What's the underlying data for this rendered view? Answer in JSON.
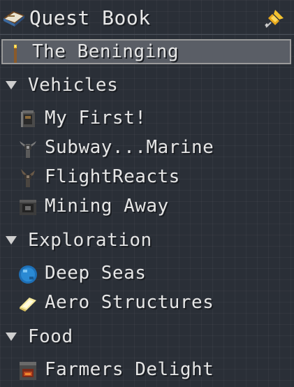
{
  "header": {
    "title": "Quest Book",
    "book_icon": "book-icon",
    "pin_icon": "pin-icon"
  },
  "selected": {
    "label": "The Beninging",
    "icon": "torch-icon"
  },
  "categories": [
    {
      "label": "Vehicles",
      "items": [
        {
          "label": "My First!",
          "icon": "engine-block-icon"
        },
        {
          "label": "Subway...Marine",
          "icon": "propeller-icon"
        },
        {
          "label": "FlightReacts",
          "icon": "flight-propeller-icon"
        },
        {
          "label": "Mining Away",
          "icon": "drill-block-icon"
        }
      ]
    },
    {
      "label": "Exploration",
      "items": [
        {
          "label": "Deep Seas",
          "icon": "water-orb-icon"
        },
        {
          "label": "Aero Structures",
          "icon": "glowing-crystal-icon"
        }
      ]
    },
    {
      "label": "Food",
      "items": [
        {
          "label": "Farmers Delight",
          "icon": "stove-icon"
        }
      ]
    }
  ]
}
